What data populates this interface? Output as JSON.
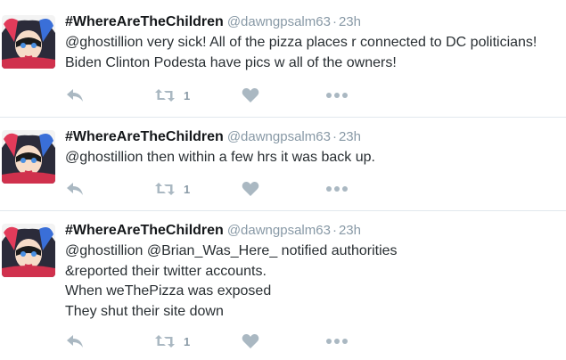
{
  "tweets": [
    {
      "name": "#WhereAreTheChildren",
      "handle": "@dawngpsalm63",
      "separator": "·",
      "time": "23h",
      "lines": [
        "@ghostillion very sick! All of the pizza places r connected to DC politicians!",
        "Biden Clinton Podesta have pics w all of the owners!"
      ],
      "retweet_count": "1"
    },
    {
      "name": "#WhereAreTheChildren",
      "handle": "@dawngpsalm63",
      "separator": "·",
      "time": "23h",
      "lines": [
        "@ghostillion then within a few hrs it was back up."
      ],
      "retweet_count": "1"
    },
    {
      "name": "#WhereAreTheChildren",
      "handle": "@dawngpsalm63",
      "separator": "·",
      "time": "23h",
      "lines": [
        "@ghostillion @Brian_Was_Here_ notified authorities",
        "&reported their twitter accounts.",
        "When weThePizza was exposed",
        "They shut their site down"
      ],
      "retweet_count": "1"
    }
  ],
  "icons": {
    "reply": "reply-icon",
    "retweet": "retweet-icon",
    "like": "heart-icon",
    "more": "more-icon"
  },
  "colors": {
    "icon_gray": "#aab8c2",
    "muted_text": "#8899a6",
    "divider": "#e1e8ed"
  }
}
